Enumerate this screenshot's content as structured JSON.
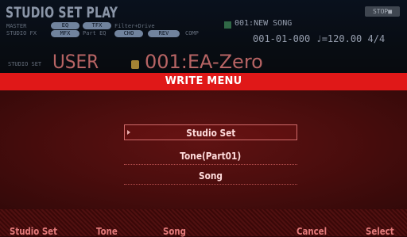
{
  "header": {
    "title": "STUDIO SET PLAY",
    "master_label": "MASTER",
    "studio_fx_label": "STUDIO FX",
    "chips": [
      "EQ",
      "TFX",
      "MFX",
      "CHO",
      "REV"
    ],
    "filter_text": "Filter+Drive",
    "part_eq_label": "Part EQ",
    "comp_label": "COMP",
    "song_name": "001:NEW SONG",
    "song_position": "001-01-000  ♩=120.00  4/4",
    "stop_label": "STOP■",
    "studio_set_label": "STUDIO SET",
    "studio_set_bank": "USER",
    "studio_set_name": "001:EA-Zero"
  },
  "dialog": {
    "title": "WRITE MENU",
    "items": [
      {
        "label": "Studio Set",
        "selected": true
      },
      {
        "label": "Tone(Part01)",
        "selected": false
      },
      {
        "label": "Song",
        "selected": false
      }
    ]
  },
  "function_bar": {
    "buttons": [
      "Studio Set",
      "Tone",
      "Song",
      "Cancel",
      "Select"
    ]
  }
}
